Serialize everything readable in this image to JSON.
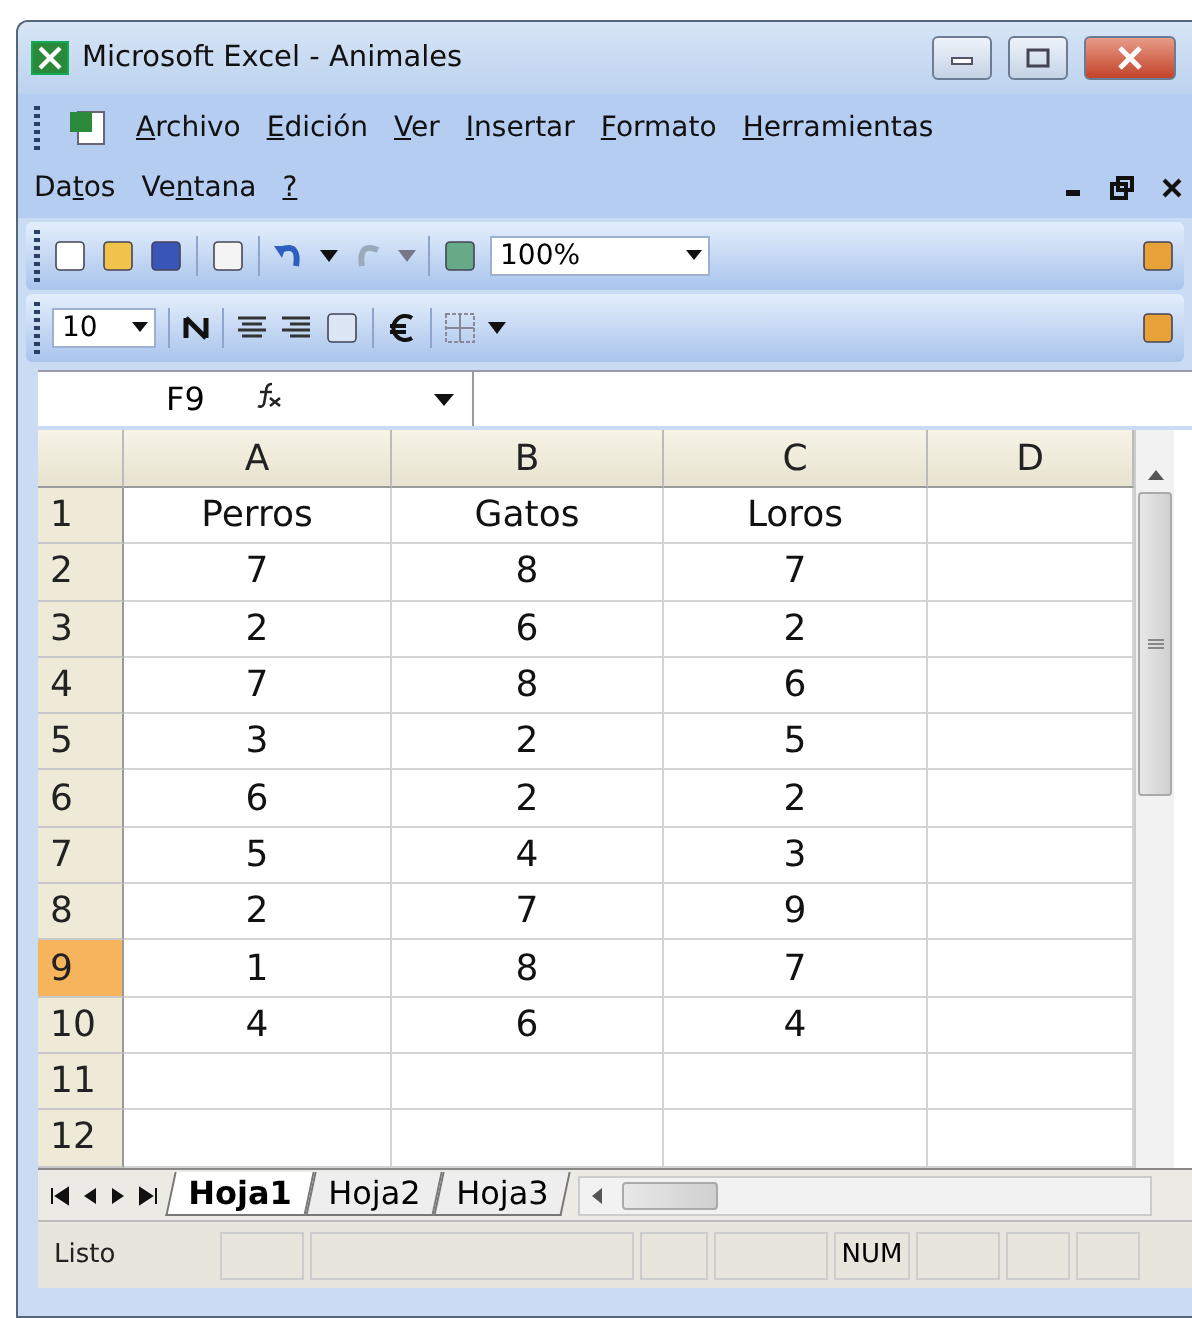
{
  "window": {
    "title": "Microsoft Excel - Animales"
  },
  "menu": [
    {
      "key": "A",
      "post": "rchivo"
    },
    {
      "key": "E",
      "post": "dición"
    },
    {
      "key": "V",
      "post": "er"
    },
    {
      "key": "I",
      "post": "nsertar"
    },
    {
      "key": "F",
      "post": "ormato"
    },
    {
      "key": "H",
      "post": "erramientas"
    },
    {
      "pre": "Da",
      "key": "t",
      "post": "os"
    },
    {
      "pre": "Ve",
      "key": "n",
      "post": "tana"
    },
    {
      "key": "?"
    }
  ],
  "standard_toolbar": {
    "zoom": "100%"
  },
  "formatting_toolbar": {
    "font_size": "10"
  },
  "formula_bar": {
    "name_box": "F9"
  },
  "columns": [
    "A",
    "B",
    "C",
    "D"
  ],
  "rows": [
    {
      "header": "1",
      "cells": [
        "Perros",
        "Gatos",
        "Loros",
        ""
      ],
      "selected": false
    },
    {
      "header": "2",
      "cells": [
        "7",
        "8",
        "7",
        ""
      ],
      "selected": false
    },
    {
      "header": "3",
      "cells": [
        "2",
        "6",
        "2",
        ""
      ],
      "selected": false
    },
    {
      "header": "4",
      "cells": [
        "7",
        "8",
        "6",
        ""
      ],
      "selected": false
    },
    {
      "header": "5",
      "cells": [
        "3",
        "2",
        "5",
        ""
      ],
      "selected": false
    },
    {
      "header": "6",
      "cells": [
        "6",
        "2",
        "2",
        ""
      ],
      "selected": false
    },
    {
      "header": "7",
      "cells": [
        "5",
        "4",
        "3",
        ""
      ],
      "selected": false
    },
    {
      "header": "8",
      "cells": [
        "2",
        "7",
        "9",
        ""
      ],
      "selected": false
    },
    {
      "header": "9",
      "cells": [
        "1",
        "8",
        "7",
        ""
      ],
      "selected": true
    },
    {
      "header": "10",
      "cells": [
        "4",
        "6",
        "4",
        ""
      ],
      "selected": false
    },
    {
      "header": "11",
      "cells": [
        "",
        "",
        "",
        ""
      ],
      "selected": false
    },
    {
      "header": "12",
      "cells": [
        "",
        "",
        "",
        ""
      ],
      "selected": false
    }
  ],
  "sheet_tabs": [
    {
      "label": "Hoja1",
      "selected": true
    },
    {
      "label": "Hoja2",
      "selected": false
    },
    {
      "label": "Hoja3",
      "selected": false
    }
  ],
  "status_bar": {
    "text": "Listo",
    "num": "NUM"
  }
}
